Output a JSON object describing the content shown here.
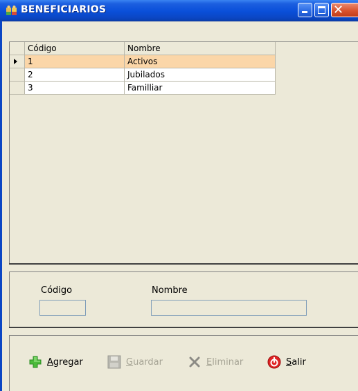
{
  "window": {
    "title": "BENEFICIARIOS"
  },
  "grid": {
    "columns": [
      "Código",
      "Nombre"
    ],
    "rows": [
      {
        "codigo": "1",
        "nombre": "Activos",
        "selected": true
      },
      {
        "codigo": "2",
        "nombre": "Jubilados",
        "selected": false
      },
      {
        "codigo": "3",
        "nombre": "Familliar",
        "selected": false
      }
    ]
  },
  "form": {
    "codigo_label": "Código",
    "nombre_label": "Nombre",
    "codigo_value": "",
    "nombre_value": ""
  },
  "toolbar": {
    "add": {
      "label_first": "A",
      "label_rest": "gregar",
      "icon": "plus-icon",
      "enabled": true
    },
    "save": {
      "label_first": "G",
      "label_rest": "uardar",
      "icon": "floppy-disk-icon",
      "enabled": false
    },
    "delete": {
      "label_first": "E",
      "label_rest": "liminar",
      "icon": "x-delete-icon",
      "enabled": false
    },
    "exit": {
      "label_first": "S",
      "label_rest": "alir",
      "icon": "power-exit-icon",
      "enabled": true
    }
  },
  "colors": {
    "titlebar": "#0a4fd9",
    "selected_row": "#fbd6a8",
    "window_bg": "#ece9d8"
  }
}
